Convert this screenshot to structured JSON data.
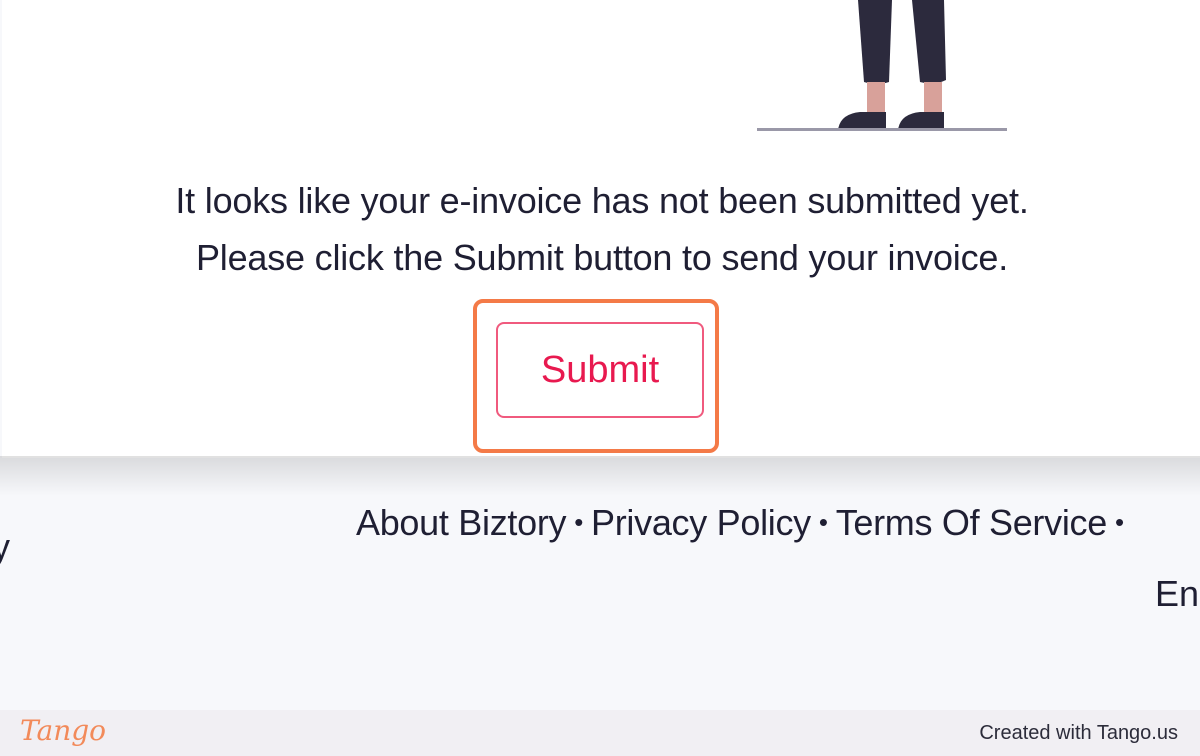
{
  "message": {
    "line1": "It looks like your e-invoice has not been submitted yet.",
    "line2": "Please click the Submit button to send your invoice."
  },
  "submit_button": {
    "label": "Submit"
  },
  "footer": {
    "left_fragment": "y",
    "links": [
      {
        "label": "About Biztory"
      },
      {
        "label": "Privacy Policy"
      },
      {
        "label": "Terms Of Service"
      }
    ],
    "separator": "•",
    "language_fragment": "En"
  },
  "tango": {
    "logo": "Tango",
    "credit": "Created with Tango.us"
  },
  "colors": {
    "accent": "#e8194f",
    "highlight": "#f47a47",
    "text": "#1f1f33"
  }
}
